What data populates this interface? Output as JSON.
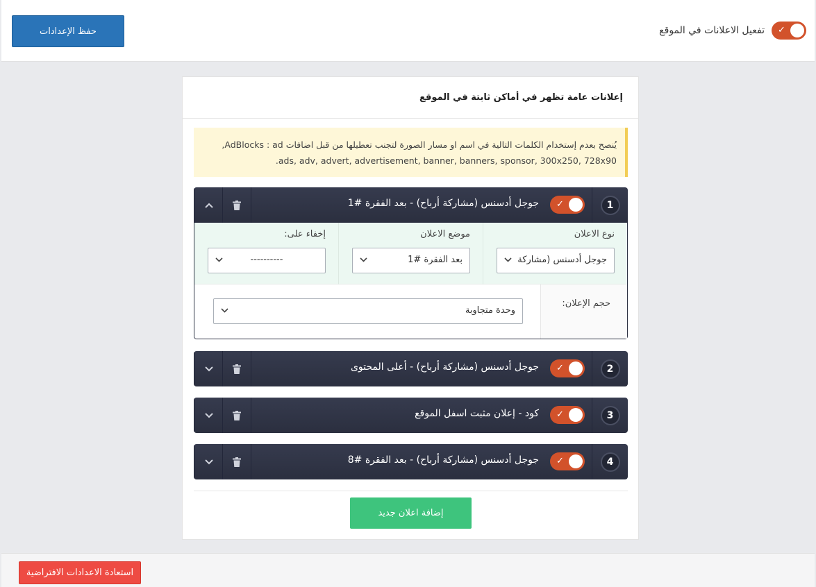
{
  "toolbar": {
    "save_label": "حفظ الإعدادات",
    "master_toggle_label": "تفعيل الاعلانات في الموقع",
    "master_toggle_on": true
  },
  "panel": {
    "title": "إعلانات عامة تظهر في أماكن ثابتة في الموقع",
    "notice_line1": "يُنصح بعدم إستخدام الكلمات التالية في اسم او مسار الصورة لتجنب تعطيلها من قبل اضافات AdBlocks : ad,",
    "notice_line2": "ads, adv, advert, advertisement, banner, banners, sponsor, 300x250, 728x90."
  },
  "ads": [
    {
      "number": "1",
      "title": "جوجل أدسنس (مشاركة أرباح) - بعد الفقرة #1",
      "enabled": true,
      "expanded": true
    },
    {
      "number": "2",
      "title": "جوجل أدسنس (مشاركة أرباح) - أعلى المحتوى",
      "enabled": true,
      "expanded": false
    },
    {
      "number": "3",
      "title": "كود - إعلان مثبت اسفل الموقع",
      "enabled": true,
      "expanded": false
    },
    {
      "number": "4",
      "title": "جوجل أدسنس (مشاركة أرباح) - بعد الفقرة #8",
      "enabled": true,
      "expanded": false
    }
  ],
  "ad_form": {
    "type_label": "نوع الاعلان",
    "type_value": "جوجل أدسنس (مشاركة",
    "position_label": "موضع الاعلان",
    "position_value": "بعد الفقرة #1",
    "hide_label": "إخفاء على:",
    "hide_value": "----------",
    "size_label": "حجم الإعلان:",
    "size_value": "وحدة متجاوبة"
  },
  "add_button_label": "إضافة اعلان جديد",
  "reset_button_label": "استعادة الاعدادات الافتراضية",
  "colors": {
    "save_button": "#2a74b8",
    "toggle_on": "#d2522b",
    "ad_header": "#2f3445",
    "form_row": "#ecf8f2",
    "add_button": "#3ec47d",
    "reset_button": "#ee4b43",
    "notice_bg": "#fef7d8"
  },
  "icons": {
    "check": "check-icon",
    "trash": "trash-icon",
    "chevron_up": "chevron-up-icon",
    "chevron_down": "chevron-down-icon"
  }
}
